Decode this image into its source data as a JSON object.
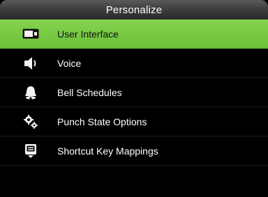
{
  "header": {
    "title": "Personalize"
  },
  "menu": {
    "items": [
      {
        "label": "User Interface",
        "icon": "display-icon",
        "selected": true
      },
      {
        "label": "Voice",
        "icon": "speaker-icon",
        "selected": false
      },
      {
        "label": "Bell Schedules",
        "icon": "bell-icon",
        "selected": false
      },
      {
        "label": "Punch State Options",
        "icon": "gears-icon",
        "selected": false
      },
      {
        "label": "Shortcut Key Mappings",
        "icon": "keyboard-key-icon",
        "selected": false
      }
    ]
  },
  "colors": {
    "selected_bg": "#7ccb46",
    "screen_bg": "#000000",
    "titlebar_bg": "#3a3a3a",
    "text": "#ffffff"
  }
}
